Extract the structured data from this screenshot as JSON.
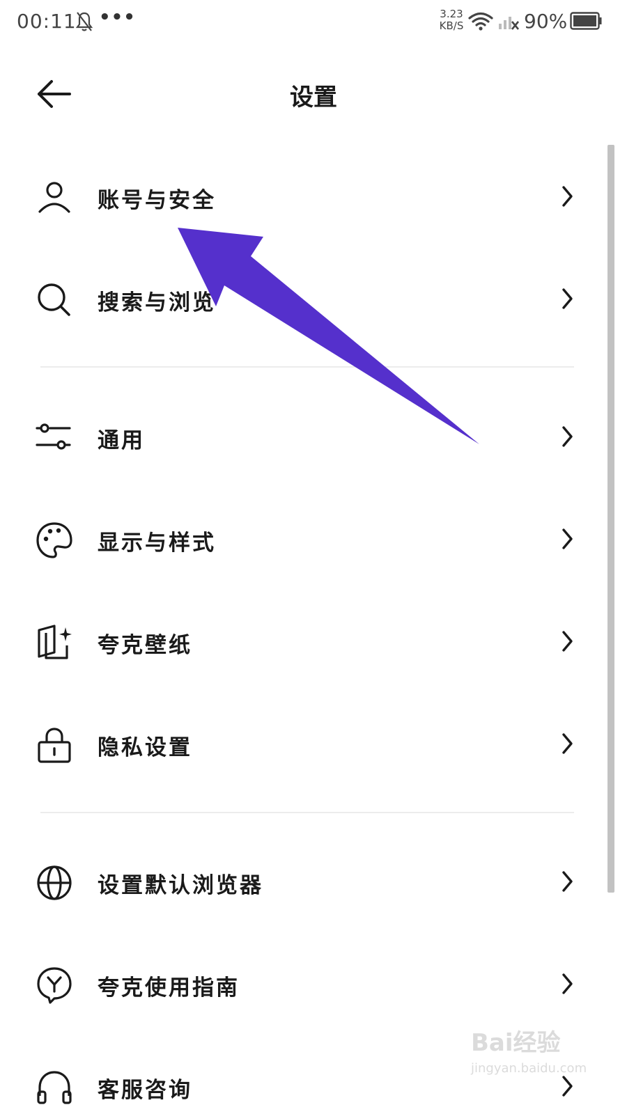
{
  "status_bar": {
    "time": "00:11",
    "more": "•••",
    "net_speed_value": "3.23",
    "net_speed_unit": "KB/S",
    "battery_percent": "90%"
  },
  "header": {
    "title": "设置"
  },
  "items": [
    {
      "label": "账号与安全",
      "icon": "user-icon"
    },
    {
      "label": "搜索与浏览",
      "icon": "search-icon"
    },
    {
      "label": "通用",
      "icon": "sliders-icon"
    },
    {
      "label": "显示与样式",
      "icon": "palette-icon"
    },
    {
      "label": "夸克壁纸",
      "icon": "wallpaper-icon"
    },
    {
      "label": "隐私设置",
      "icon": "lock-icon"
    },
    {
      "label": "设置默认浏览器",
      "icon": "globe-icon"
    },
    {
      "label": "夸克使用指南",
      "icon": "guide-icon"
    },
    {
      "label": "客服咨询",
      "icon": "headset-icon"
    }
  ],
  "annotation": {
    "color": "#5530cc",
    "points_to": "账号与安全"
  },
  "watermark": {
    "brand": "Bai经验",
    "url": "jingyan.baidu.com"
  }
}
